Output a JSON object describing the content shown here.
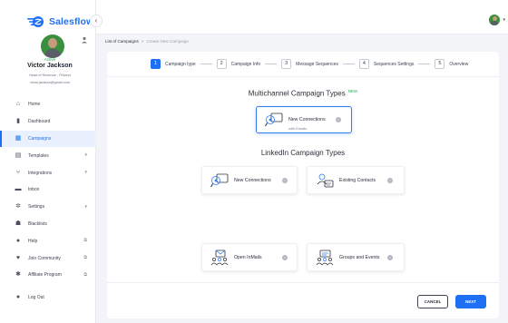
{
  "app": {
    "logo_text": "Salesflow",
    "collapse_icon": "chevron-left-icon"
  },
  "user": {
    "status": "Active",
    "name": "Victor Jackson",
    "role": "Head of Revenue - Finland",
    "email": "victor.jackson@gmail.com"
  },
  "nav": {
    "items": [
      {
        "label": "Home",
        "icon": "home-icon",
        "glyph": "⌂",
        "right": ""
      },
      {
        "label": "Dashboard",
        "icon": "bar-chart-icon",
        "glyph": "▮",
        "right": ""
      },
      {
        "label": "Campaigns",
        "icon": "grid-icon",
        "glyph": "▦",
        "right": ""
      },
      {
        "label": "Templates",
        "icon": "template-icon",
        "glyph": "▤",
        "right": "▾"
      },
      {
        "label": "Integrations",
        "icon": "integrations-icon",
        "glyph": "⑂",
        "right": "▾"
      },
      {
        "label": "Inbox",
        "icon": "inbox-icon",
        "glyph": "▬",
        "right": ""
      },
      {
        "label": "Settings",
        "icon": "gear-icon",
        "glyph": "✲",
        "right": "▾"
      },
      {
        "label": "Blacklists",
        "icon": "users-icon",
        "glyph": "☗",
        "right": ""
      },
      {
        "label": "Help",
        "icon": "help-icon",
        "glyph": "●",
        "right": "⧉"
      },
      {
        "label": "Join Community",
        "icon": "heart-icon",
        "glyph": "♥",
        "right": "⧉"
      },
      {
        "label": "Affiliate Program",
        "icon": "star-icon",
        "glyph": "✱",
        "right": "⧉"
      },
      {
        "label": "Log Out",
        "icon": "logout-icon",
        "glyph": "●",
        "right": ""
      }
    ]
  },
  "breadcrumb": {
    "parent": "List of Campaigns",
    "separator": ">",
    "current": "Create New Campaign"
  },
  "stepper": {
    "steps": [
      {
        "num": "1",
        "label": "Campaign type"
      },
      {
        "num": "2",
        "label": "Campaign Info"
      },
      {
        "num": "3",
        "label": "Message Sequences"
      },
      {
        "num": "4",
        "label": "Sequences Settings"
      },
      {
        "num": "5",
        "label": "Overview"
      }
    ]
  },
  "multichannel": {
    "title": "Multichannel Campaign Types",
    "new_tag": "NEW",
    "card": {
      "label": "New Connections",
      "sub": "with Emails"
    }
  },
  "linkedin": {
    "title": "LinkedIn Campaign Types",
    "cards": [
      {
        "label": "New Connections"
      },
      {
        "label": "Existing Contacts"
      },
      {
        "label": "Open InMails"
      },
      {
        "label": "Groups and Events"
      }
    ]
  },
  "footer": {
    "cancel_label": "CANCEL",
    "next_label": "NEXT"
  },
  "colors": {
    "accent": "#1e6ff3",
    "active_green": "#1faa52"
  }
}
